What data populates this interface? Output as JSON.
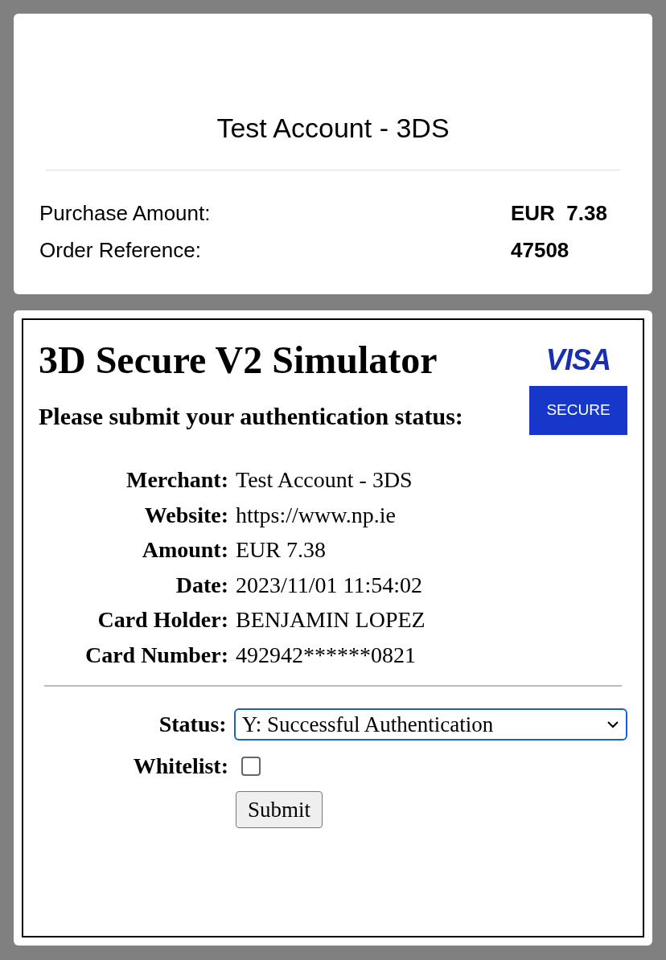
{
  "header": {
    "title": "Test Account - 3DS",
    "rows": [
      {
        "label": "Purchase Amount:",
        "value": "EUR  7.38"
      },
      {
        "label": "Order Reference:",
        "value": "47508"
      }
    ]
  },
  "simulator": {
    "title": "3D Secure V2 Simulator",
    "logo": {
      "brand": "VISA",
      "badge": "SECURE"
    },
    "prompt": "Please submit your authentication status:",
    "details": [
      {
        "label": "Merchant:",
        "value": "Test Account - 3DS"
      },
      {
        "label": "Website:",
        "value": "https://www.np.ie"
      },
      {
        "label": "Amount:",
        "value": "EUR 7.38"
      },
      {
        "label": "Date:",
        "value": "2023/11/01 11:54:02"
      },
      {
        "label": "Card Holder:",
        "value": "BENJAMIN LOPEZ"
      },
      {
        "label": "Card Number:",
        "value": "492942******0821"
      }
    ],
    "form": {
      "status": {
        "label": "Status:",
        "value": "Y: Successful Authentication"
      },
      "whitelist": {
        "label": "Whitelist:",
        "checked": false
      },
      "submit": "Submit"
    }
  }
}
